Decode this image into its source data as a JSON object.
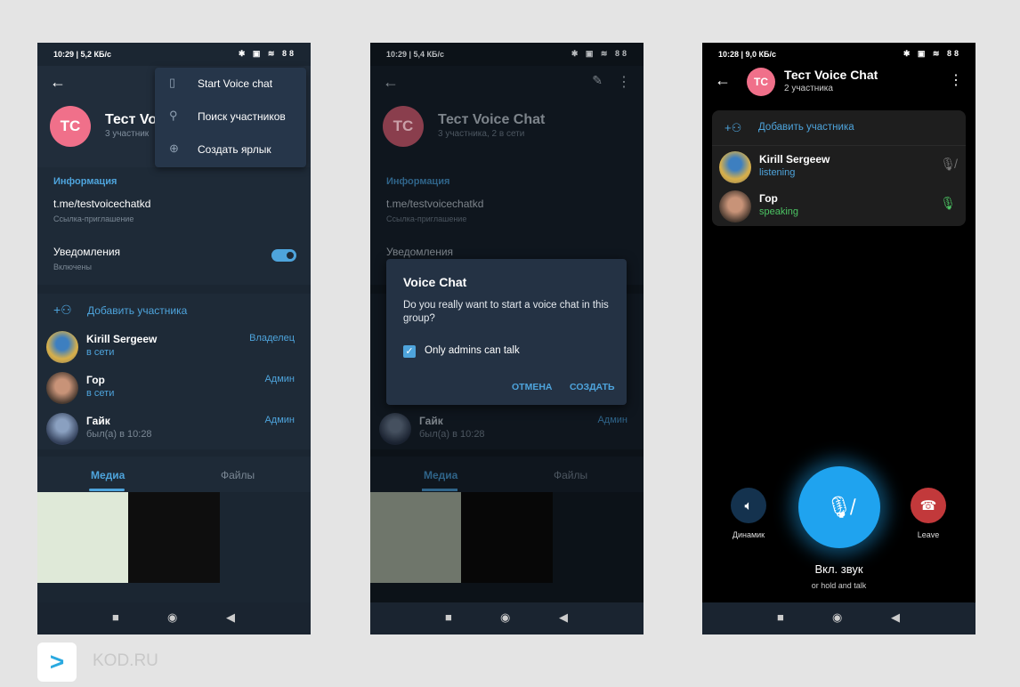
{
  "phone1": {
    "status": {
      "time": "10:29 | 5,2 КБ/с",
      "icons": "✱ ▣ ≋ 88"
    },
    "chat": {
      "initials": "TC",
      "title": "Тест Vo",
      "subtitle": "3 участник"
    },
    "menu": [
      {
        "icon": "voice-chat-icon",
        "label": "Start Voice chat"
      },
      {
        "icon": "search-icon",
        "label": "Поиск участников"
      },
      {
        "icon": "add-shortcut-icon",
        "label": "Создать ярлык"
      }
    ],
    "info": {
      "header": "Информация",
      "link": "t.me/testvoicechatkd",
      "link_caption": "Ссылка-приглашение",
      "notifications": "Уведомления",
      "notifications_state": "Включены",
      "notifications_on": true
    },
    "add_member": "Добавить участника",
    "members": [
      {
        "name": "Kirill Sergeew",
        "status": "в сети",
        "role": "Владелец"
      },
      {
        "name": "Гор",
        "status": "в сети",
        "role": "Админ"
      },
      {
        "name": "Гайк",
        "status": "был(а) в 10:28",
        "role": "Админ"
      }
    ],
    "tabs": {
      "media": "Медиа",
      "files": "Файлы"
    }
  },
  "phone2": {
    "status": {
      "time": "10:29 | 5,4 КБ/с",
      "icons": "✱ ▣ ≋ 88"
    },
    "chat": {
      "initials": "TC",
      "title": "Тест Voice Chat",
      "subtitle": "3 участника, 2 в сети"
    },
    "info": {
      "header": "Информация",
      "link": "t.me/testvoicechatkd",
      "link_caption": "Ссылка-приглашение",
      "notifications": "Уведомления"
    },
    "members": [
      {
        "name": "Гайк",
        "status": "был(а) в 10:28",
        "role": "Админ"
      }
    ],
    "tabs": {
      "media": "Медиа",
      "files": "Файлы"
    },
    "dialog": {
      "title": "Voice Chat",
      "message": "Do you really want to start a voice chat in this group?",
      "checkbox_label": "Only admins can talk",
      "checkbox_checked": true,
      "cancel": "ОТМЕНА",
      "create": "СОЗДАТЬ"
    }
  },
  "phone3": {
    "status": {
      "time": "10:28 | 9,0 КБ/с",
      "icons": "✱ ▣ ≋ 88"
    },
    "chat": {
      "initials": "TC",
      "title": "Тест Voice Chat",
      "subtitle": "2 участника"
    },
    "add_member": "Добавить участника",
    "participants": [
      {
        "name": "Kirill Sergeew",
        "status": "listening",
        "mic": "mic-muted-icon"
      },
      {
        "name": "Гор",
        "status": "speaking",
        "mic": "mic-icon"
      }
    ],
    "controls": {
      "speaker": "Динамик",
      "leave": "Leave",
      "main": "Вкл. звук",
      "hint": "or hold and talk"
    }
  },
  "watermark": "KOD.RU",
  "colors": {
    "accent": "#4ea4dc",
    "speaking": "#4cc463",
    "leave": "#c2393b",
    "mic_button": "#1fa3ef",
    "avatar": "#f0708a"
  }
}
